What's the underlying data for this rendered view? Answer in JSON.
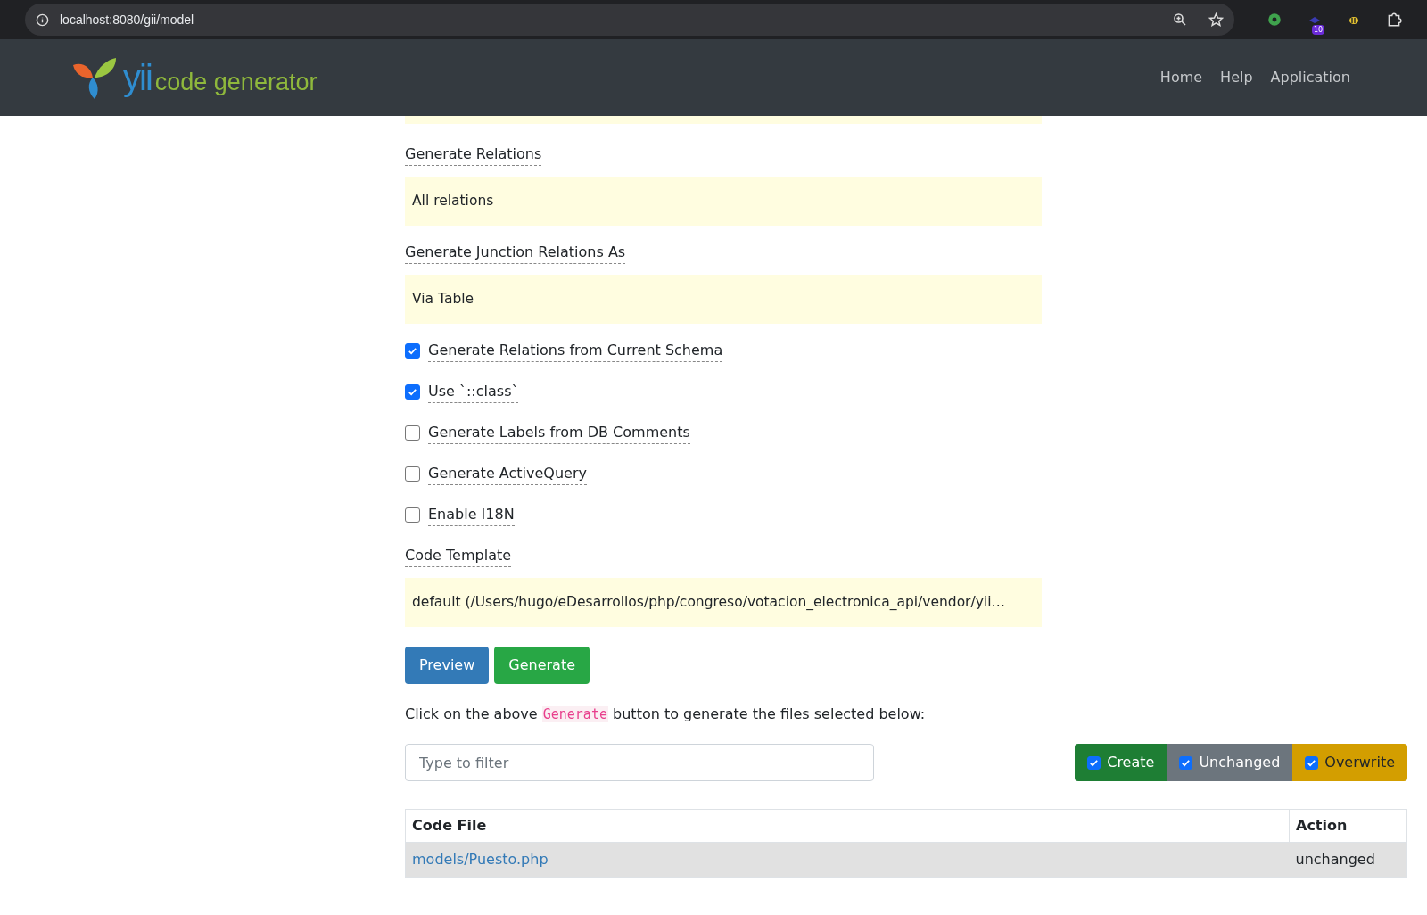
{
  "browser": {
    "url": "localhost:8080/gii/model",
    "extension_badge": "10"
  },
  "navbar": {
    "logo_word": "yii",
    "logo_text": "code generator",
    "links": [
      "Home",
      "Help",
      "Application"
    ]
  },
  "form": {
    "fields": [
      {
        "kind": "select",
        "label": "Generate Relations",
        "value": "All relations"
      },
      {
        "kind": "select",
        "label": "Generate Junction Relations As",
        "value": "Via Table"
      },
      {
        "kind": "checkbox",
        "label": "Generate Relations from Current Schema",
        "checked": true
      },
      {
        "kind": "checkbox",
        "label": "Use `::class`",
        "checked": true
      },
      {
        "kind": "checkbox",
        "label": "Generate Labels from DB Comments",
        "checked": false
      },
      {
        "kind": "checkbox",
        "label": "Generate ActiveQuery",
        "checked": false
      },
      {
        "kind": "checkbox",
        "label": "Enable I18N",
        "checked": false
      },
      {
        "kind": "select",
        "label": "Code Template",
        "value": "default (/Users/hugo/eDesarrollos/php/congreso/votacion_electronica_api/vendor/yii…"
      }
    ],
    "buttons": [
      {
        "label": "Preview",
        "kind": "primary"
      },
      {
        "label": "Generate",
        "kind": "success"
      }
    ]
  },
  "hint": {
    "text_before": "Click on the above ",
    "code": "Generate",
    "text_after": " button to generate the files selected below:"
  },
  "filter": {
    "placeholder": "Type to filter"
  },
  "toggles": [
    {
      "label": "Create",
      "checked": true,
      "color": "#1e7e34"
    },
    {
      "label": "Unchanged",
      "checked": true,
      "color": "#6c757d"
    },
    {
      "label": "Overwrite",
      "checked": true,
      "color": "#d39e00"
    }
  ],
  "table": {
    "columns": [
      "Code File",
      "Action"
    ],
    "rows": [
      {
        "file": "models/Puesto.php",
        "action": "unchanged"
      }
    ]
  }
}
